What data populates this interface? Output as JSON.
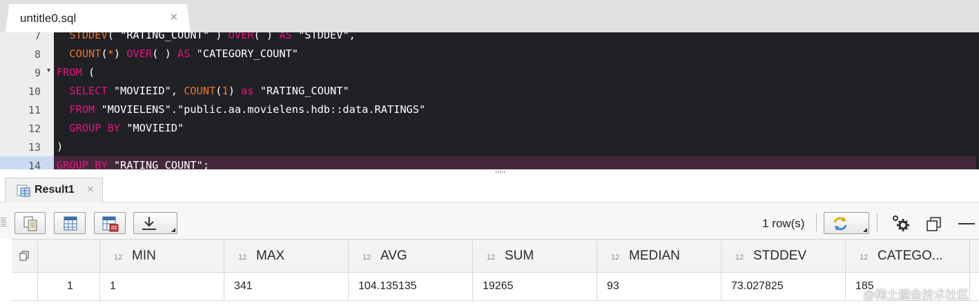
{
  "editor_tab": {
    "title": "untitle0.sql",
    "close": "×"
  },
  "editor": {
    "lines": [
      {
        "num": "7",
        "segments": [
          {
            "t": "  "
          },
          {
            "c": "fn",
            "t": "STDDEV"
          },
          {
            "t": "( \"RATING_COUNT\" ) "
          },
          {
            "c": "kw",
            "t": "OVER"
          },
          {
            "t": "( ) "
          },
          {
            "c": "kw",
            "t": "AS"
          },
          {
            "t": " \"STDDEV\","
          }
        ]
      },
      {
        "num": "8",
        "segments": [
          {
            "t": "  "
          },
          {
            "c": "fn",
            "t": "COUNT"
          },
          {
            "t": "("
          },
          {
            "c": "fn",
            "t": "*"
          },
          {
            "t": ") "
          },
          {
            "c": "kw",
            "t": "OVER"
          },
          {
            "t": "( ) "
          },
          {
            "c": "kw",
            "t": "AS"
          },
          {
            "t": " \"CATEGORY_COUNT\""
          }
        ]
      },
      {
        "num": "9",
        "fold": true,
        "segments": [
          {
            "c": "kw",
            "t": "FROM"
          },
          {
            "t": " ("
          }
        ]
      },
      {
        "num": "10",
        "segments": [
          {
            "t": "  "
          },
          {
            "c": "kw",
            "t": "SELECT"
          },
          {
            "t": " \"MOVIEID\", "
          },
          {
            "c": "fn",
            "t": "COUNT"
          },
          {
            "t": "("
          },
          {
            "c": "fn",
            "t": "1"
          },
          {
            "t": ") "
          },
          {
            "c": "kw",
            "t": "as"
          },
          {
            "t": " \"RATING_COUNT\""
          }
        ]
      },
      {
        "num": "11",
        "segments": [
          {
            "t": "  "
          },
          {
            "c": "kw",
            "t": "FROM"
          },
          {
            "t": " \"MOVIELENS\".\"public.aa.movielens.hdb::data.RATINGS\""
          }
        ]
      },
      {
        "num": "12",
        "segments": [
          {
            "t": "  "
          },
          {
            "c": "kw",
            "t": "GROUP BY"
          },
          {
            "t": " \"MOVIEID\""
          }
        ]
      },
      {
        "num": "13",
        "segments": [
          {
            "t": ")"
          }
        ]
      },
      {
        "num": "14",
        "active": true,
        "segments": [
          {
            "c": "kw",
            "t": "GROUP BY"
          },
          {
            "t": " \"RATING_COUNT\";"
          }
        ]
      }
    ]
  },
  "result_tab": {
    "title": "Result1",
    "close": "×"
  },
  "toolbar": {
    "buttons": [
      "copy-icon",
      "table-icon",
      "table-settings-icon",
      "download-icon"
    ],
    "rows_label": "1 row(s)",
    "refresh_icon": "refresh-icon",
    "settings_icon": "gear-icon",
    "maximize_icon": "restore-window-icon",
    "minimize_icon": "minimize-icon"
  },
  "grid": {
    "corner_icon": "copy-rows-icon",
    "columns": [
      {
        "type": "12",
        "name": "MIN"
      },
      {
        "type": "12",
        "name": "MAX"
      },
      {
        "type": "12",
        "name": "AVG"
      },
      {
        "type": "12",
        "name": "SUM"
      },
      {
        "type": "12",
        "name": "MEDIAN"
      },
      {
        "type": "12",
        "name": "STDDEV"
      },
      {
        "type": "12",
        "name": "CATEGO..."
      }
    ],
    "rows": [
      {
        "num": "1",
        "values": [
          "1",
          "341",
          "104.135135",
          "19265",
          "93",
          "73.027825",
          "185"
        ]
      }
    ]
  },
  "watermark": "@稀土掘金技术社区"
}
